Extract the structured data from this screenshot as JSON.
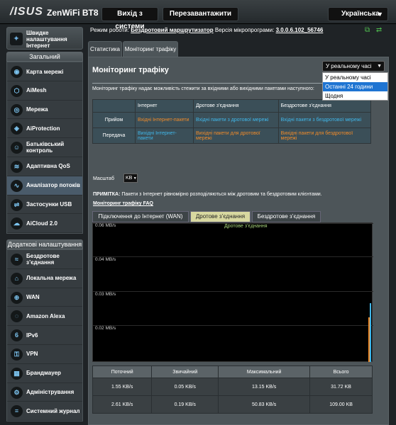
{
  "header": {
    "brand": "/ISUS",
    "model": "ZenWiFi BT8",
    "logout_label": "Вихід з системи",
    "reboot_label": "Перезавантажити",
    "language": "Українська"
  },
  "status": {
    "mode_label": "Режим роботи:",
    "mode_value": "Бездротовий маршрутизатор",
    "firmware_label": "Версія мікропрограми:",
    "firmware_value": "3.0.0.6.102_56746"
  },
  "sidebar": {
    "quick_setup": "Швидке налаштування Інтернет",
    "general_header": "Загальний",
    "general_items": [
      {
        "label": "Карта мережі",
        "icon": "network-map-icon"
      },
      {
        "label": "AiMesh",
        "icon": "aimesh-icon"
      },
      {
        "label": "Мережа",
        "icon": "network-icon"
      },
      {
        "label": "AiProtection",
        "icon": "aiprotection-icon"
      },
      {
        "label": "Батьківський контроль",
        "icon": "parental-control-icon"
      },
      {
        "label": "Адаптивна QoS",
        "icon": "qos-icon"
      },
      {
        "label": "Аналізатор потоків",
        "icon": "traffic-analyzer-icon"
      },
      {
        "label": "Застосунки USB",
        "icon": "usb-icon"
      },
      {
        "label": "AiCloud 2.0",
        "icon": "aicloud-icon"
      }
    ],
    "advanced_header": "Додаткові налаштування",
    "advanced_items": [
      {
        "label": "Бездротове з’єднання",
        "icon": "wireless-icon"
      },
      {
        "label": "Локальна мережа",
        "icon": "lan-icon"
      },
      {
        "label": "WAN",
        "icon": "wan-icon"
      },
      {
        "label": "Amazon Alexa",
        "icon": "alexa-icon"
      },
      {
        "label": "IPv6",
        "icon": "ipv6-icon"
      },
      {
        "label": "VPN",
        "icon": "vpn-icon"
      },
      {
        "label": "Брандмауер",
        "icon": "firewall-icon"
      },
      {
        "label": "Адміністрування",
        "icon": "administration-icon"
      },
      {
        "label": "Системний журнал",
        "icon": "syslog-icon"
      }
    ]
  },
  "tabs": [
    "Статистика",
    "Моніторинг трафіку"
  ],
  "panel": {
    "title": "Моніторинг трафіку",
    "mode_selected": "У реальному часі",
    "mode_options": [
      "У реальному часі",
      "Останні 24 години",
      "Щодня"
    ],
    "description": "Моніторинг трафіку надає можливість стежити за вхідними або вихідними пакетами наступного:",
    "col_headers": [
      "",
      "Інтернет",
      "Дротове з’єднання",
      "Бездротове з’єднання"
    ],
    "rows": [
      {
        "label": "Прийом",
        "cells": [
          "Вхідні Інтернет-пакети",
          "Вхідні пакети з дротової мережі",
          "Вхідні пакети з бездротової мережі"
        ]
      },
      {
        "label": "Передача",
        "cells": [
          "Вихідні Інтернет-пакети",
          "Вихідні пакети для дротової мережі",
          "Вихідні пакети для бездротової мережі"
        ]
      }
    ],
    "scale_label": "Масштаб",
    "scale_value": "KB",
    "note_bold": "ПРИМІТКА:",
    "note_text": " Пакети з Інтернет рівномірно розподіляються між дротовим та бездротовим клієнтами.",
    "faq_link": "Моніторинг трафіку FAQ",
    "graph_tabs": [
      "Підключення до Інтернет (WAN)",
      "Дротове з’єднання",
      "Бездротове з’єднання"
    ],
    "graph_title": "Дротове з’єднання",
    "y_ticks": [
      "0.06 MB/s",
      "0.04 MB/s",
      "0.03 MB/s",
      "0.02 MB/s"
    ],
    "stats_headers": [
      "Поточний",
      "Звичайний",
      "Максимальний",
      "Всього"
    ],
    "stats_rows": [
      {
        "color": "cyan",
        "values": [
          "1.55 KB/s",
          "0.05 KB/s",
          "13.15 KB/s",
          "31.72 KB"
        ]
      },
      {
        "color": "orange",
        "values": [
          "2.61 KB/s",
          "0.19 KB/s",
          "50.83 KB/s",
          "109.00 KB"
        ]
      }
    ]
  },
  "colors": {
    "rx": "#40b6e8",
    "tx": "#f08b2a",
    "selected_tab": "#d8d8a0"
  }
}
